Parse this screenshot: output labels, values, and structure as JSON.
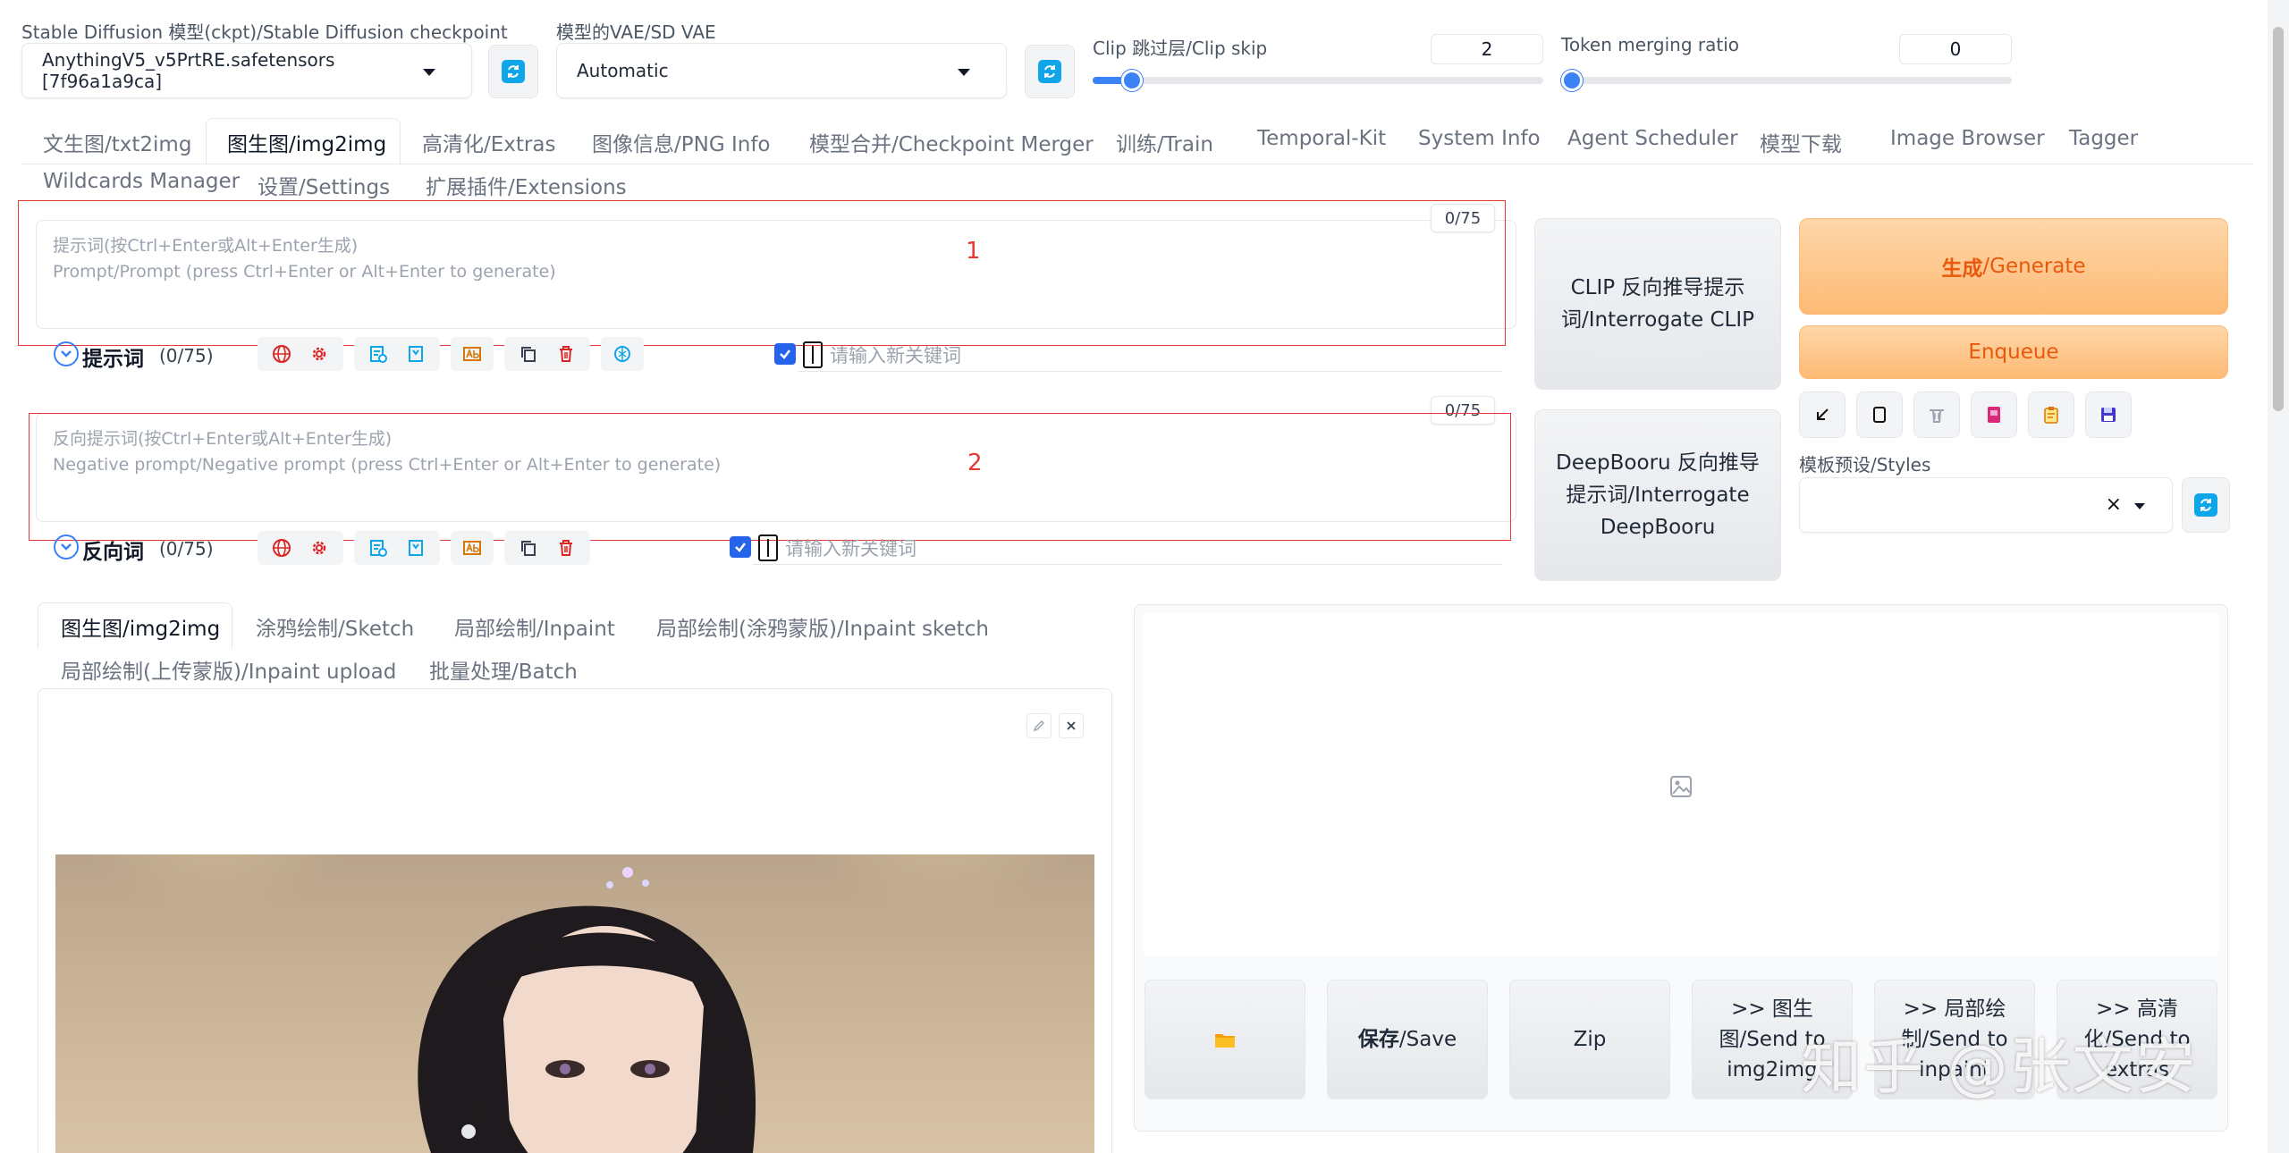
{
  "checkpoint": {
    "label": "Stable Diffusion 模型(ckpt)/Stable Diffusion checkpoint",
    "value": "AnythingV5_v5PrtRE.safetensors [7f96a1a9ca]"
  },
  "vae": {
    "label": "模型的VAE/SD VAE",
    "value": "Automatic"
  },
  "clip_skip": {
    "label": "Clip 跳过层/Clip skip",
    "value": "2",
    "fraction": 0.08
  },
  "token_merging": {
    "label": "Token merging ratio",
    "value": "0",
    "fraction": 0.0
  },
  "main_tabs": [
    {
      "label": "文生图/txt2img",
      "active": false
    },
    {
      "label": "图生图/img2img",
      "active": true
    },
    {
      "label": "高清化/Extras",
      "active": false
    },
    {
      "label": "图像信息/PNG Info",
      "active": false
    },
    {
      "label": "模型合并/Checkpoint Merger",
      "active": false
    },
    {
      "label": "训练/Train",
      "active": false
    },
    {
      "label": "Temporal-Kit",
      "active": false
    },
    {
      "label": "System Info",
      "active": false
    },
    {
      "label": "Agent Scheduler",
      "active": false
    },
    {
      "label": "模型下载",
      "active": false
    },
    {
      "label": "Image Browser",
      "active": false
    },
    {
      "label": "Tagger",
      "active": false
    },
    {
      "label": "Wildcards Manager",
      "active": false
    },
    {
      "label": "设置/Settings",
      "active": false
    },
    {
      "label": "扩展插件/Extensions",
      "active": false
    }
  ],
  "prompt": {
    "counter": "0/75",
    "placeholder_line1": "提示词(按Ctrl+Enter或Alt+Enter生成)",
    "placeholder_line2": "Prompt/Prompt (press Ctrl+Enter or Alt+Enter to generate)",
    "annotation": "1",
    "toolbar_label": "提示词",
    "toolbar_count": "(0/75)",
    "keyword_placeholder": "请输入新关键词"
  },
  "negative": {
    "counter": "0/75",
    "placeholder_line1": "反向提示词(按Ctrl+Enter或Alt+Enter生成)",
    "placeholder_line2": "Negative prompt/Negative prompt (press Ctrl+Enter or Alt+Enter to generate)",
    "annotation": "2",
    "toolbar_label": "反向词",
    "toolbar_count": "(0/75)",
    "keyword_placeholder": "请输入新关键词"
  },
  "interrogate": {
    "clip_line1": "CLIP 反向推导提示",
    "clip_line2": "词/Interrogate CLIP",
    "deepbooru_line1": "DeepBooru 反向推导",
    "deepbooru_line2": "提示词/Interrogate",
    "deepbooru_line3": "DeepBooru"
  },
  "generate": {
    "label_bold": "生成",
    "label_rest": "/Generate",
    "enqueue": "Enqueue"
  },
  "styles": {
    "label": "模板预设/Styles",
    "clear": "×"
  },
  "sub_tabs": [
    {
      "label": "图生图/img2img",
      "active": true
    },
    {
      "label": "涂鸦绘制/Sketch",
      "active": false
    },
    {
      "label": "局部绘制/Inpaint",
      "active": false
    },
    {
      "label": "局部绘制(涂鸦蒙版)/Inpaint sketch",
      "active": false
    },
    {
      "label": "局部绘制(上传蒙版)/Inpaint upload",
      "active": false
    },
    {
      "label": "批量处理/Batch",
      "active": false
    }
  ],
  "save_buttons": {
    "save_bold": "保存",
    "save_rest": "/Save",
    "zip": "Zip",
    "send_img2img_l1": ">> 图生",
    "send_img2img_l2": "图/Send to",
    "send_img2img_l3": "img2img",
    "send_inpaint_l1": ">> 局部绘",
    "send_inpaint_l2": "制/Send to",
    "send_inpaint_l3": "inpaint",
    "send_extras_l1": ">> 高清",
    "send_extras_l2": "化/Send to",
    "send_extras_l3": "extras"
  },
  "watermark": "知乎 @张文安",
  "colors": {
    "accent": "#3b82f6",
    "generate": "#fdba74",
    "annotation": "#e53935",
    "refresh": "#0ea5e9"
  }
}
